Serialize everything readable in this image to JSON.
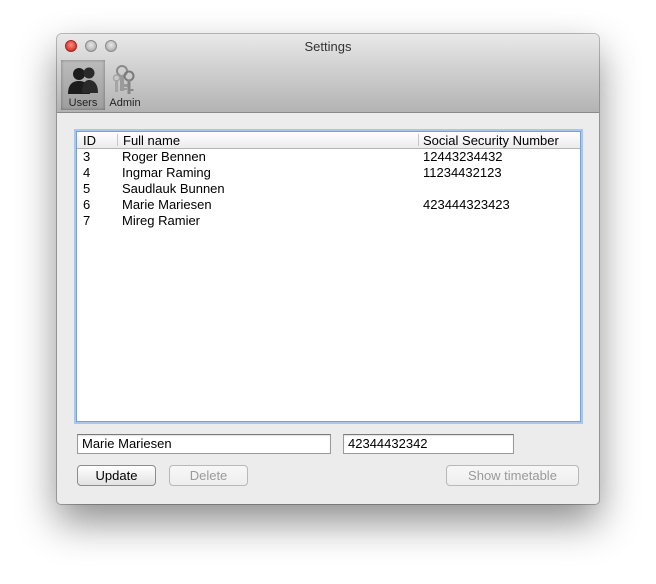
{
  "window": {
    "title": "Settings"
  },
  "toolbar": {
    "items": [
      {
        "label": "Users",
        "icon": "users-icon",
        "selected": true
      },
      {
        "label": "Admin",
        "icon": "keys-icon",
        "selected": false
      }
    ]
  },
  "table": {
    "columns": [
      "ID",
      "Full name",
      "Social Security Number"
    ],
    "rows": [
      {
        "id": "3",
        "name": "Roger Bennen",
        "ssn": "12443234432"
      },
      {
        "id": "4",
        "name": "Ingmar Raming",
        "ssn": "11234432123"
      },
      {
        "id": "5",
        "name": "Saudlauk Bunnen",
        "ssn": ""
      },
      {
        "id": "6",
        "name": "Marie Mariesen",
        "ssn": "423444323423"
      },
      {
        "id": "7",
        "name": "Mireg Ramier",
        "ssn": ""
      }
    ]
  },
  "form": {
    "name_value": "Marie Mariesen",
    "ssn_value": "42344432342"
  },
  "buttons": {
    "update": "Update",
    "delete": "Delete",
    "show_timetable": "Show timetable"
  },
  "colors": {
    "focus_ring": "#a9c6ee",
    "close_button": "#e0443a"
  }
}
